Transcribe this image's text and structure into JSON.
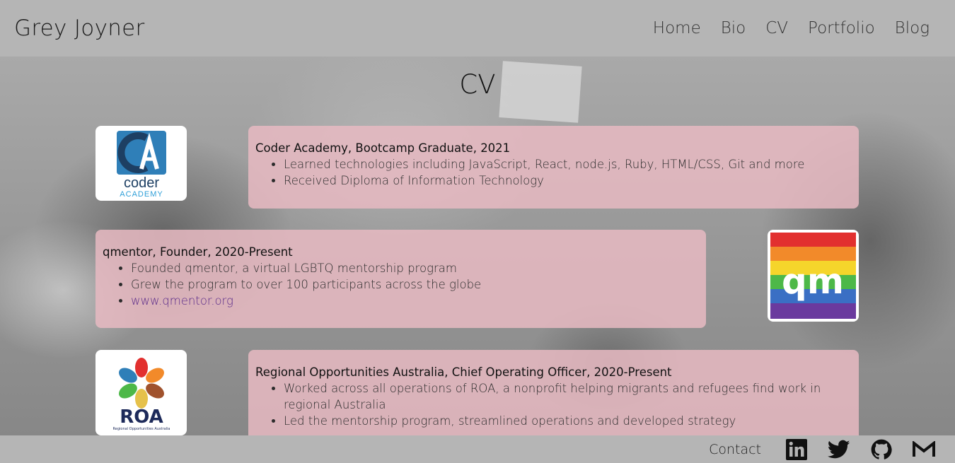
{
  "header": {
    "brand": "Grey Joyner",
    "nav": [
      "Home",
      "Bio",
      "CV",
      "Portfolio",
      "Blog"
    ]
  },
  "main": {
    "title": "CV",
    "entries": [
      {
        "logo": "coder-academy-logo",
        "logo_text": [
          "coder",
          "ACADEMY"
        ],
        "title": "Coder Academy, Bootcamp Graduate, 2021",
        "bullets": [
          "Learned technologies including JavaScript, React, node.js, Ruby, HTML/CSS, Git and more",
          "Received Diploma of Information Technology"
        ]
      },
      {
        "logo": "qmentor-logo",
        "logo_text": "qm",
        "title": "qmentor, Founder, 2020-Present",
        "bullets": [
          "Founded qmentor, a virtual LGBTQ mentorship program",
          "Grew the program to over 100 participants across the globe"
        ],
        "link": "www.qmentor.org"
      },
      {
        "logo": "roa-logo",
        "logo_text": [
          "ROA",
          "Regional Opportunities Australia"
        ],
        "title": "Regional Opportunities Australia, Chief Operating Officer, 2020-Present",
        "bullets": [
          "Worked across all operations of ROA, a nonprofit helping migrants and refugees find work in regional Australia",
          "Led the mentorship program, streamlined operations and developed strategy"
        ]
      }
    ]
  },
  "footer": {
    "contact": "Contact",
    "icons": [
      "linkedin-icon",
      "twitter-icon",
      "github-icon",
      "gmail-icon"
    ]
  },
  "colors": {
    "bar": "#b5b5b5",
    "card": "#e7bac2",
    "link": "#5a2a8a"
  }
}
